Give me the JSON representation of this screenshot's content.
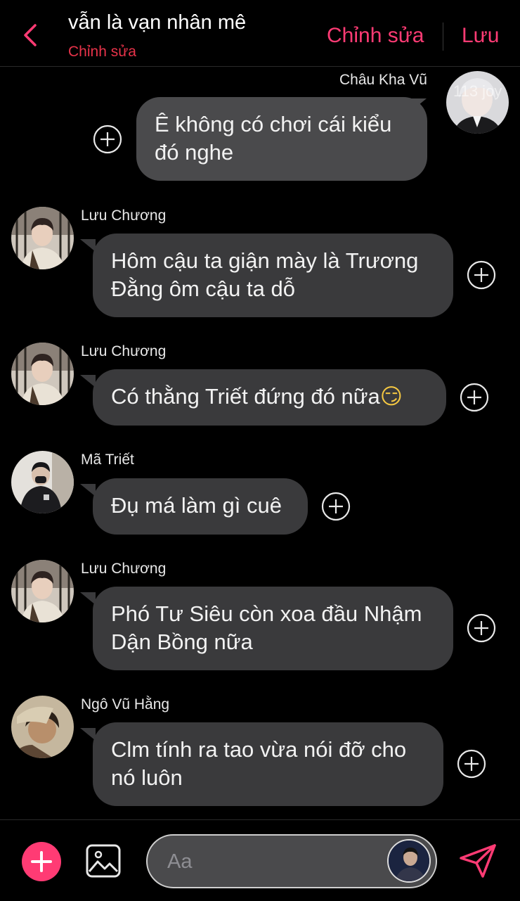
{
  "header": {
    "back_icon": "chevron-left-icon",
    "title": "vẫn là vạn nhân mê",
    "subtitle": "Chỉnh sửa",
    "edit_label": "Chỉnh sửa",
    "save_label": "Lưu",
    "accent_color": "#ff3b74"
  },
  "messages": [
    {
      "sender": "Châu Kha Vũ",
      "text": "Ê không có chơi cái kiểu đó nghe",
      "side": "right",
      "avatar_overlay": "113 joy"
    },
    {
      "sender": "Lưu Chương",
      "text": "Hôm cậu ta giận mày là Trương Đằng ôm cậu ta dỗ",
      "side": "left"
    },
    {
      "sender": "Lưu Chương",
      "text": "Có thằng Triết đứng đó nữa",
      "emoji": "😏",
      "side": "left"
    },
    {
      "sender": "Mã Triết",
      "text": "Đụ má làm gì cuê",
      "side": "left"
    },
    {
      "sender": "Lưu Chương",
      "text": "Phó Tư Siêu còn xoa đầu Nhậm Dận Bồng nữa",
      "side": "left"
    },
    {
      "sender": "Ngô Vũ Hằng",
      "text": "Clm tính ra tao vừa nói đỡ cho nó luôn",
      "side": "left"
    }
  ],
  "composer": {
    "placeholder": "Aa",
    "add_icon": "plus-icon",
    "image_icon": "image-icon",
    "send_icon": "send-icon"
  }
}
